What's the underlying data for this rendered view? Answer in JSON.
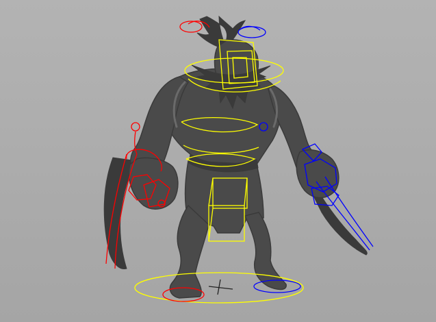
{
  "viewport": {
    "background_top": "#b3b3b3",
    "background_bottom": "#a5a5a5",
    "mesh_color": "#4a4a4a",
    "mesh_shadow": "#3a3a3a",
    "mesh_highlight": "#6a6a6a"
  },
  "rig": {
    "center_controls_color": "#ffff00",
    "left_side_controls_color": "#ff0000",
    "right_side_controls_color": "#0000ff",
    "origin_marker_color": "#222222"
  },
  "icons": {
    "world_origin": "crosshair-icon"
  }
}
